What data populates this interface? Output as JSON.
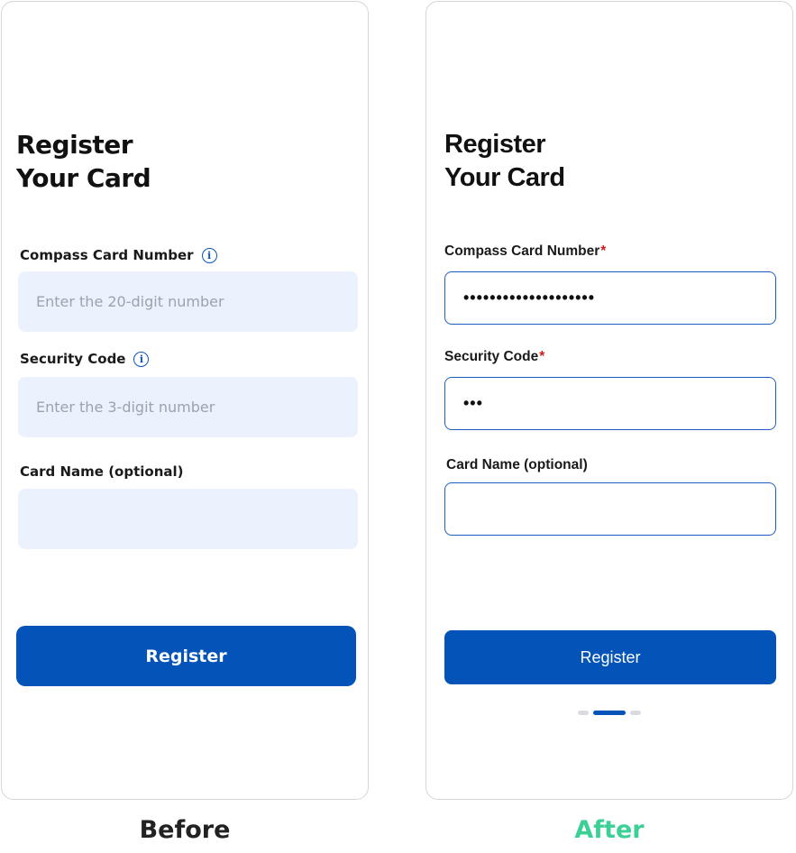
{
  "colors": {
    "primary": "#0353b8",
    "required": "#d11b1b",
    "after_caption": "#3ccf96"
  },
  "before": {
    "title_line1": "Register",
    "title_line2": "Your Card",
    "card_number_label": "Compass Card Number",
    "card_number_placeholder": "Enter the 20-digit number",
    "security_label": "Security Code",
    "security_placeholder": "Enter the 3-digit number",
    "card_name_label": "Card Name (optional)",
    "card_name_value": "",
    "register_label": "Register",
    "info_icon_glyph": "i",
    "caption": "Before"
  },
  "after": {
    "title_line1": "Register",
    "title_line2": "Your Card",
    "card_number_label": "Compass Card Number",
    "card_number_value": "••••••••••••••••••••",
    "security_label": "Security Code",
    "security_value": "•••",
    "required_mark": "*",
    "card_name_label": "Card Name (optional)",
    "card_name_value": "",
    "register_label": "Register",
    "page_indicator": {
      "count": 3,
      "active": 2
    },
    "caption": "After"
  }
}
